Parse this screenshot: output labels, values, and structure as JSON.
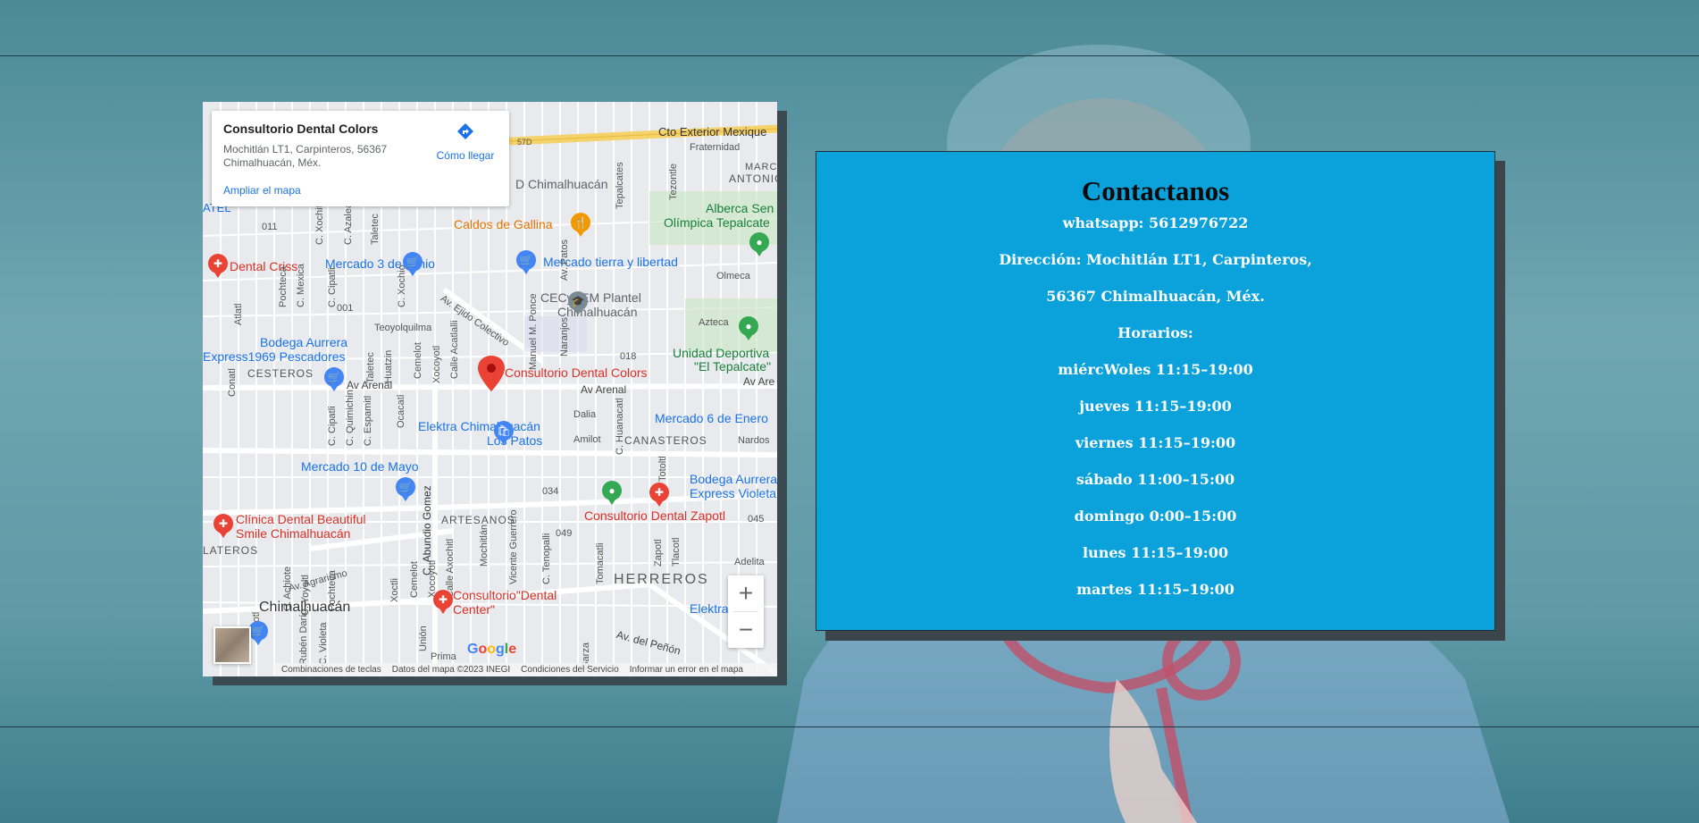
{
  "colors": {
    "panel_bg": "#0ba2dc",
    "page_bg": "#5f9aa6",
    "map_link": "#1a73e8"
  },
  "map": {
    "place_card": {
      "title": "Consultorio Dental Colors",
      "address_line1": "Mochitlán LT1, Carpinteros, 56367",
      "address_line2": "Chimalhuacán, Méx.",
      "enlarge_link": "Ampliar el mapa",
      "directions_label": "Cómo llegar",
      "directions_icon": "directions-icon"
    },
    "labels": {
      "cto_exterior": "Cto Exterior Mexique",
      "fraternidad": "Fraternidad",
      "marc": "MARC",
      "antonio": "ANTONIO",
      "chimalhuacan_top": "D Chimalhuacán",
      "caldos": "Caldos de Gallina",
      "alberca": "Alberca Sen",
      "olimpica": "Olímpica Tepalcate",
      "dental_criss": "Dental Criss",
      "mercado_3": "Mercado 3 de Junio",
      "mercado_tierra": "Mercado tierra y libertad",
      "olmeca": "Olmeca",
      "cecytem1": "CECyTEM Plantel",
      "cecytem2": "Chimalhuacán",
      "azteca": "Azteca",
      "bodega_aurrera1": "Bodega Aurrera",
      "bodega_aurrera2": "Express1969 Pescadores",
      "unidad1": "Unidad Deportiva",
      "unidad2": "\"El Tepalcate\"",
      "cesteros": "CESTEROS",
      "av_arenal_left": "Av Arenal",
      "consultorio_colors": "Consultorio Dental Colors",
      "av_arenal_mid": "Av Arenal",
      "av_are": "Av Are",
      "elektra1": "Elektra Chimalhuacán",
      "elektra2": "Los Patos",
      "mercado_6": "Mercado 6 de Enero",
      "canasteros": "CANASTEROS",
      "nardos": "Nardos",
      "mercado_10": "Mercado 10 de Mayo",
      "bodega_violeta1": "Bodega Aurrera",
      "bodega_violeta2": "Express Violeta",
      "clinica1": "Clínica Dental Beautiful",
      "clinica2": "Smile Chimalhuacán",
      "artesanos": "ARTESANOS",
      "consultorio_zapotl": "Consultorio Dental Zapotl",
      "lateros": "LATEROS",
      "herreros": "HERREROS",
      "chimalhuacan_town": "Chimalhuacán",
      "consultorio_center1": "Consultorio\"Dental",
      "consultorio_center2": "Center\"",
      "av_penon": "Av. del Peñón",
      "elektra_r": "Elektra",
      "adelita": "Adelita",
      "atel": "ATEL",
      "dalia": "Dalia",
      "amilot": "Amilot",
      "av_agrarismo": "Av. Agrarismo",
      "av_ejido": "Av. Ejido Colectivo",
      "teoyolquilma": "Teoyolquilma",
      "n011": "011",
      "n001": "001",
      "n018": "018",
      "n034": "034",
      "n049": "049",
      "n045": "045",
      "n57d": "57D",
      "calle_xochitl": "C. Xochitl",
      "calle_azalea": "C. Azalea",
      "taletec": "Taletec",
      "tepalcates": "Tepalcates",
      "tezontle": "Tezontle",
      "av_patos": "Av. Patos",
      "manuel_ponce": "Manuel M. Ponce",
      "naranjos": "Naranjos",
      "c_cipatli": "C. Cipatli",
      "c_mexica": "C. Mexica",
      "pochteca": "Pochteca",
      "atlatl": "Atlatl",
      "c_xochio": "C. Xochio",
      "calle_acatl": "Calle Acatlalli",
      "c_quimichin": "C. Quimichin",
      "c_espamitl": "C. Espamitl",
      "ocacatl": "Ocacatl",
      "huatzin": "Huatzin",
      "cemelot": "Cemelot",
      "xocoyotl": "Xocoyotl",
      "calle_axachil": "Calle Axochitl",
      "c_huanacatl": "C. Huanacatl",
      "totoltl": "Totoltl",
      "c_abundio": "C. Abundio Gomez",
      "mochitlan": "Mochitlán",
      "vicente": "Vicente Guerrero",
      "c_tenopalli": "C. Tenopalli",
      "tomacatli": "Tomacatli",
      "zapotl": "Zapotl",
      "tlacotl": "Tlacotl",
      "xoctli": "Xoctli",
      "union": "Unión",
      "primer": "Prima",
      "garza": "Garza",
      "c_achiote": "C. Achiote",
      "c_yoyoltl": "C. Yoyoltl",
      "ayotl": "Ayotl",
      "c_violeta": "C. Violeta",
      "ruben": "Rubén Darío",
      "conatl": "Conatl",
      "c_cipatli2": "C. Cipatli"
    },
    "google_logo": "Google",
    "footer": {
      "shortcuts": "Combinaciones de teclas",
      "map_data": "Datos del mapa ©2023 INEGI",
      "terms": "Condiciones del Servicio",
      "report": "Informar un error en el mapa"
    },
    "zoom_in": "+",
    "zoom_out": "−"
  },
  "contact": {
    "title": "Contactanos",
    "whatsapp": "whatsapp: 5612976722",
    "address_line1": "Dirección: Mochitlán LT1, Carpinteros,",
    "address_line2": "56367 Chimalhuacán, Méx.",
    "hours_title": "Horarios:",
    "hours": [
      "miércWoles 11:15–19:00",
      "jueves 11:15–19:00",
      "viernes 11:15–19:00",
      "sábado 11:00–15:00",
      "domingo 0:00–15:00",
      "lunes 11:15–19:00",
      "martes 11:15–19:00"
    ]
  }
}
